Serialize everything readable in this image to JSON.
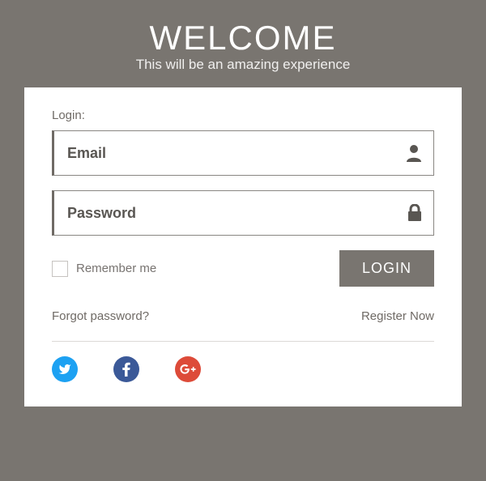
{
  "header": {
    "title": "WELCOME",
    "subtitle": "This will be an amazing experience"
  },
  "form": {
    "login_label": "Login:",
    "email_placeholder": "Email",
    "password_placeholder": "Password",
    "remember_label": "Remember me",
    "login_button": "LOGIN"
  },
  "links": {
    "forgot": "Forgot password?",
    "register": "Register Now"
  },
  "social": {
    "twitter": "twitter",
    "facebook": "facebook",
    "googleplus": "google-plus"
  }
}
